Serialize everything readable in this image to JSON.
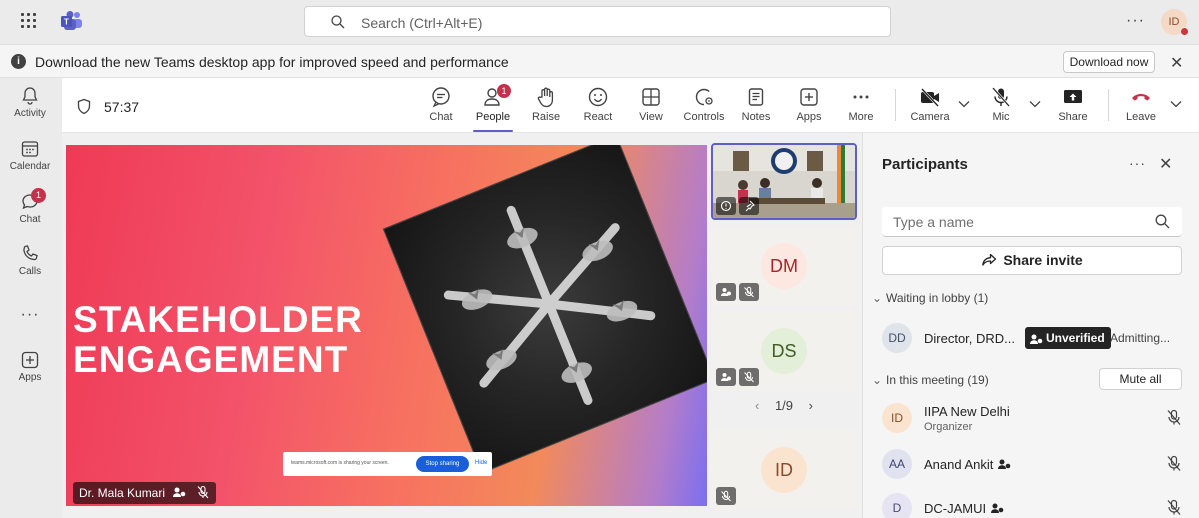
{
  "topbar": {
    "search_placeholder": "Search (Ctrl+Alt+E)",
    "more": "···",
    "user_initials": "ID"
  },
  "banner": {
    "message": "Download the new Teams desktop app for improved speed and performance",
    "download_label": "Download now",
    "close": "✕",
    "info": "i"
  },
  "rail": {
    "items": [
      {
        "label": "Activity"
      },
      {
        "label": "Calendar"
      },
      {
        "label": "Chat",
        "badge": "1"
      },
      {
        "label": "Calls"
      },
      {
        "label": "···"
      },
      {
        "label": "Apps"
      }
    ]
  },
  "meeting": {
    "timer": "57:37",
    "toolbar": [
      {
        "label": "Chat"
      },
      {
        "label": "People",
        "badge": "1",
        "active": true
      },
      {
        "label": "Raise"
      },
      {
        "label": "React"
      },
      {
        "label": "View"
      },
      {
        "label": "Controls"
      },
      {
        "label": "Notes"
      },
      {
        "label": "Apps"
      },
      {
        "label": "More"
      },
      {
        "label": "Camera"
      },
      {
        "label": "Mic"
      },
      {
        "label": "Share"
      },
      {
        "label": "Leave"
      }
    ]
  },
  "stage": {
    "slide_title_line1": "STAKEHOLDER",
    "slide_title_line2": "ENGAGEMENT",
    "share_text": "teams.microsoft.com is sharing your screen.",
    "stop_sharing": "Stop sharing",
    "hide": "Hide",
    "presenter": "Dr. Mala Kumari"
  },
  "tiles": [
    {
      "initials": "DM"
    },
    {
      "initials": "DS"
    },
    {
      "initials": "ID"
    }
  ],
  "pager": {
    "text": "1/9",
    "prev": "‹",
    "next": "›"
  },
  "participants": {
    "title": "Participants",
    "more": "···",
    "close": "✕",
    "search_placeholder": "Type a name",
    "share_invite": "Share invite",
    "lobby_header": "Waiting in lobby (1)",
    "lobby": [
      {
        "initials": "DD",
        "name": "Director, DRD...",
        "tag": "Unverified",
        "status": "Admitting..."
      }
    ],
    "meeting_header": "In this meeting (19)",
    "mute_all": "Mute all",
    "members": [
      {
        "initials": "ID",
        "name": "IIPA New Delhi",
        "role": "Organizer"
      },
      {
        "initials": "AA",
        "name": "Anand Ankit"
      },
      {
        "initials": "D",
        "name": "DC-JAMUI"
      }
    ]
  },
  "colors": {
    "accent": "#5b5fc7",
    "badge": "#c4314b",
    "leave": "#c4314b"
  }
}
